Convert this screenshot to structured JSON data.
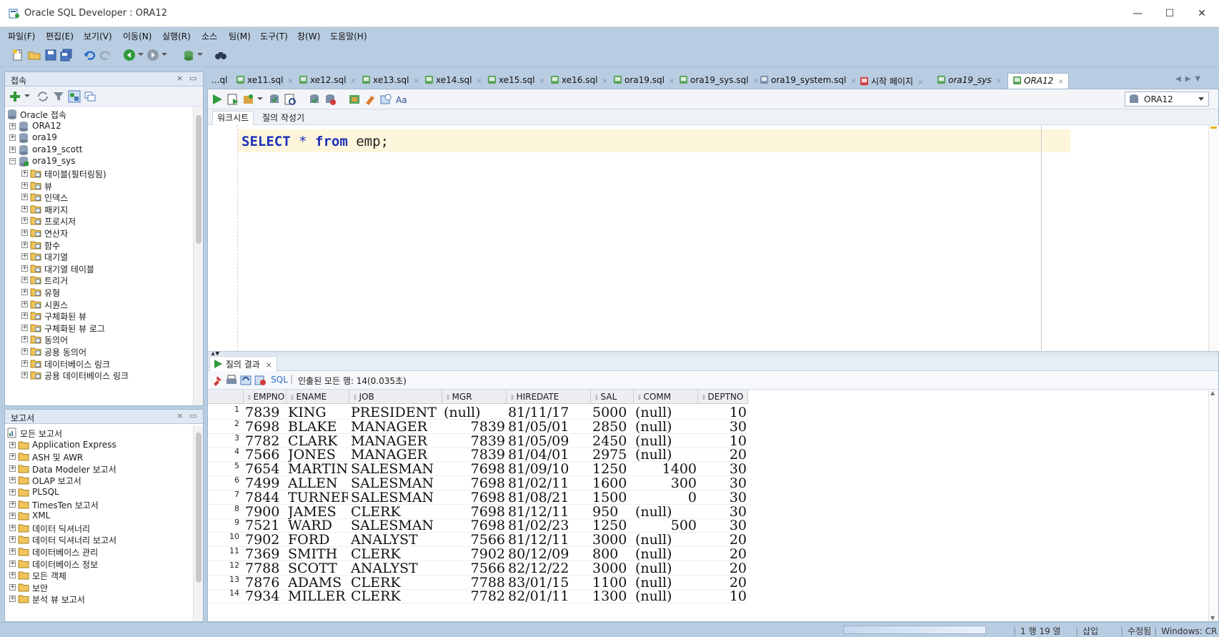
{
  "window": {
    "title": "Oracle SQL Developer : ORA12",
    "minimize": "—",
    "maximize": "☐",
    "close": "✕"
  },
  "menu": [
    "파일(F)",
    "편집(E)",
    "보기(V)",
    "이동(N)",
    "실행(R)",
    "소스",
    "팀(M)",
    "도구(T)",
    "창(W)",
    "도움말(H)"
  ],
  "connections": {
    "title": "접속",
    "tree": [
      {
        "label": "Oracle 접속",
        "level": 0,
        "icon": "database-icon"
      },
      {
        "label": "ORA12",
        "level": 1,
        "icon": "database-icon"
      },
      {
        "label": "ora19",
        "level": 1,
        "icon": "database-icon"
      },
      {
        "label": "ora19_scott",
        "level": 1,
        "icon": "database-icon"
      },
      {
        "label": "ora19_sys",
        "level": 1,
        "icon": "connected-db-icon",
        "expanded": true
      },
      {
        "label": "테이블(필터링됨)",
        "level": 2,
        "icon": "folder-table-icon"
      },
      {
        "label": "뷰",
        "level": 2,
        "icon": "folder-view-icon"
      },
      {
        "label": "인덱스",
        "level": 2,
        "icon": "folder-index-icon"
      },
      {
        "label": "패키지",
        "level": 2,
        "icon": "folder-package-icon"
      },
      {
        "label": "프로시저",
        "level": 2,
        "icon": "folder-procedure-icon"
      },
      {
        "label": "연산자",
        "level": 2,
        "icon": "folder-operator-icon"
      },
      {
        "label": "함수",
        "level": 2,
        "icon": "folder-function-icon"
      },
      {
        "label": "대기열",
        "level": 2,
        "icon": "folder-queue-icon"
      },
      {
        "label": "대기열 테이블",
        "level": 2,
        "icon": "folder-queue-table-icon"
      },
      {
        "label": "트리거",
        "level": 2,
        "icon": "folder-trigger-icon"
      },
      {
        "label": "유형",
        "level": 2,
        "icon": "folder-type-icon"
      },
      {
        "label": "시퀀스",
        "level": 2,
        "icon": "folder-sequence-icon"
      },
      {
        "label": "구체화된 뷰",
        "level": 2,
        "icon": "folder-mview-icon"
      },
      {
        "label": "구체화된 뷰 로그",
        "level": 2,
        "icon": "folder-mview-log-icon"
      },
      {
        "label": "동의어",
        "level": 2,
        "icon": "folder-synonym-icon"
      },
      {
        "label": "공용 동의어",
        "level": 2,
        "icon": "folder-public-synonym-icon"
      },
      {
        "label": "데이터베이스 링크",
        "level": 2,
        "icon": "folder-dblink-icon"
      },
      {
        "label": "공용 데이터베이스 링크",
        "level": 2,
        "icon": "folder-public-dblink-icon"
      }
    ]
  },
  "reports": {
    "title": "보고서",
    "tree": [
      {
        "label": "모든 보고서",
        "level": 0,
        "icon": "reports-icon"
      },
      {
        "label": "Application Express",
        "level": 1,
        "icon": "folder-icon"
      },
      {
        "label": "ASH 및 AWR",
        "level": 1,
        "icon": "folder-icon"
      },
      {
        "label": "Data Modeler 보고서",
        "level": 1,
        "icon": "folder-icon"
      },
      {
        "label": "OLAP 보고서",
        "level": 1,
        "icon": "folder-icon"
      },
      {
        "label": "PLSQL",
        "level": 1,
        "icon": "folder-icon"
      },
      {
        "label": "TimesTen 보고서",
        "level": 1,
        "icon": "folder-icon"
      },
      {
        "label": "XML",
        "level": 1,
        "icon": "folder-icon"
      },
      {
        "label": "데이터 딕셔너리",
        "level": 1,
        "icon": "folder-icon"
      },
      {
        "label": "데이터 딕셔너리 보고서",
        "level": 1,
        "icon": "folder-icon"
      },
      {
        "label": "데이터베이스 관리",
        "level": 1,
        "icon": "folder-icon"
      },
      {
        "label": "데이터베이스 정보",
        "level": 1,
        "icon": "folder-icon"
      },
      {
        "label": "모든 객체",
        "level": 1,
        "icon": "folder-icon"
      },
      {
        "label": "보안",
        "level": 1,
        "icon": "folder-icon"
      },
      {
        "label": "분석 뷰 보고서",
        "level": 1,
        "icon": "folder-icon"
      }
    ]
  },
  "editor_tabs": [
    {
      "label": "...ql",
      "icon": "",
      "active": false
    },
    {
      "label": "xe11.sql",
      "icon": "sql-file-icon",
      "active": false
    },
    {
      "label": "xe12.sql",
      "icon": "sql-file-icon",
      "active": false
    },
    {
      "label": "xe13.sql",
      "icon": "sql-file-icon",
      "active": false
    },
    {
      "label": "xe14.sql",
      "icon": "sql-file-icon",
      "active": false
    },
    {
      "label": "xe15.sql",
      "icon": "sql-file-icon",
      "active": false
    },
    {
      "label": "xe16.sql",
      "icon": "sql-file-icon",
      "active": false
    },
    {
      "label": "ora19.sql",
      "icon": "sql-file-icon",
      "active": false
    },
    {
      "label": "ora19_sys.sql",
      "icon": "sql-file-icon",
      "active": false
    },
    {
      "label": "ora19_system.sql",
      "icon": "document-icon",
      "active": false
    },
    {
      "label": "시작 페이지",
      "icon": "start-page-icon",
      "active": false
    },
    {
      "label": "ora19_sys",
      "icon": "sql-file-icon",
      "active": false,
      "italic": true
    },
    {
      "label": "ORA12",
      "icon": "sql-file-icon",
      "active": true
    }
  ],
  "connection_selector": "ORA12",
  "subtabs": [
    "워크시트",
    "질의 작성기"
  ],
  "sql": {
    "kw1": "SELECT",
    "star": "*",
    "kw2": "from",
    "rest": "emp;"
  },
  "result": {
    "tab": "질의 결과",
    "tab_close": "×",
    "sql_link": "SQL",
    "status": "인출된 모든 행: 14(0.035초)",
    "columns": [
      "EMPNO",
      "ENAME",
      "JOB",
      "MGR",
      "HIREDATE",
      "SAL",
      "COMM",
      "DEPTNO"
    ],
    "rows": [
      [
        "1",
        "7839",
        "KING",
        "PRESIDENT",
        "(null)",
        "81/11/17",
        "5000",
        "(null)",
        "10"
      ],
      [
        "2",
        "7698",
        "BLAKE",
        "MANAGER",
        "7839",
        "81/05/01",
        "2850",
        "(null)",
        "30"
      ],
      [
        "3",
        "7782",
        "CLARK",
        "MANAGER",
        "7839",
        "81/05/09",
        "2450",
        "(null)",
        "10"
      ],
      [
        "4",
        "7566",
        "JONES",
        "MANAGER",
        "7839",
        "81/04/01",
        "2975",
        "(null)",
        "20"
      ],
      [
        "5",
        "7654",
        "MARTIN",
        "SALESMAN",
        "7698",
        "81/09/10",
        "1250",
        "1400",
        "30"
      ],
      [
        "6",
        "7499",
        "ALLEN",
        "SALESMAN",
        "7698",
        "81/02/11",
        "1600",
        "300",
        "30"
      ],
      [
        "7",
        "7844",
        "TURNER",
        "SALESMAN",
        "7698",
        "81/08/21",
        "1500",
        "0",
        "30"
      ],
      [
        "8",
        "7900",
        "JAMES",
        "CLERK",
        "7698",
        "81/12/11",
        "950",
        "(null)",
        "30"
      ],
      [
        "9",
        "7521",
        "WARD",
        "SALESMAN",
        "7698",
        "81/02/23",
        "1250",
        "500",
        "30"
      ],
      [
        "10",
        "7902",
        "FORD",
        "ANALYST",
        "7566",
        "81/12/11",
        "3000",
        "(null)",
        "20"
      ],
      [
        "11",
        "7369",
        "SMITH",
        "CLERK",
        "7902",
        "80/12/09",
        "800",
        "(null)",
        "20"
      ],
      [
        "12",
        "7788",
        "SCOTT",
        "ANALYST",
        "7566",
        "82/12/22",
        "3000",
        "(null)",
        "20"
      ],
      [
        "13",
        "7876",
        "ADAMS",
        "CLERK",
        "7788",
        "83/01/15",
        "1100",
        "(null)",
        "20"
      ],
      [
        "14",
        "7934",
        "MILLER",
        "CLERK",
        "7782",
        "82/01/11",
        "1300",
        "(null)",
        "10"
      ]
    ]
  },
  "statusbar": {
    "position": "1 행 19 열",
    "mode": "삽입",
    "modified": "수정됨",
    "eol": "Windows: CR"
  },
  "colors": {
    "chrome": "#b9cde2",
    "keyword": "#1c2fb8",
    "current_line": "#fdf6dc"
  }
}
